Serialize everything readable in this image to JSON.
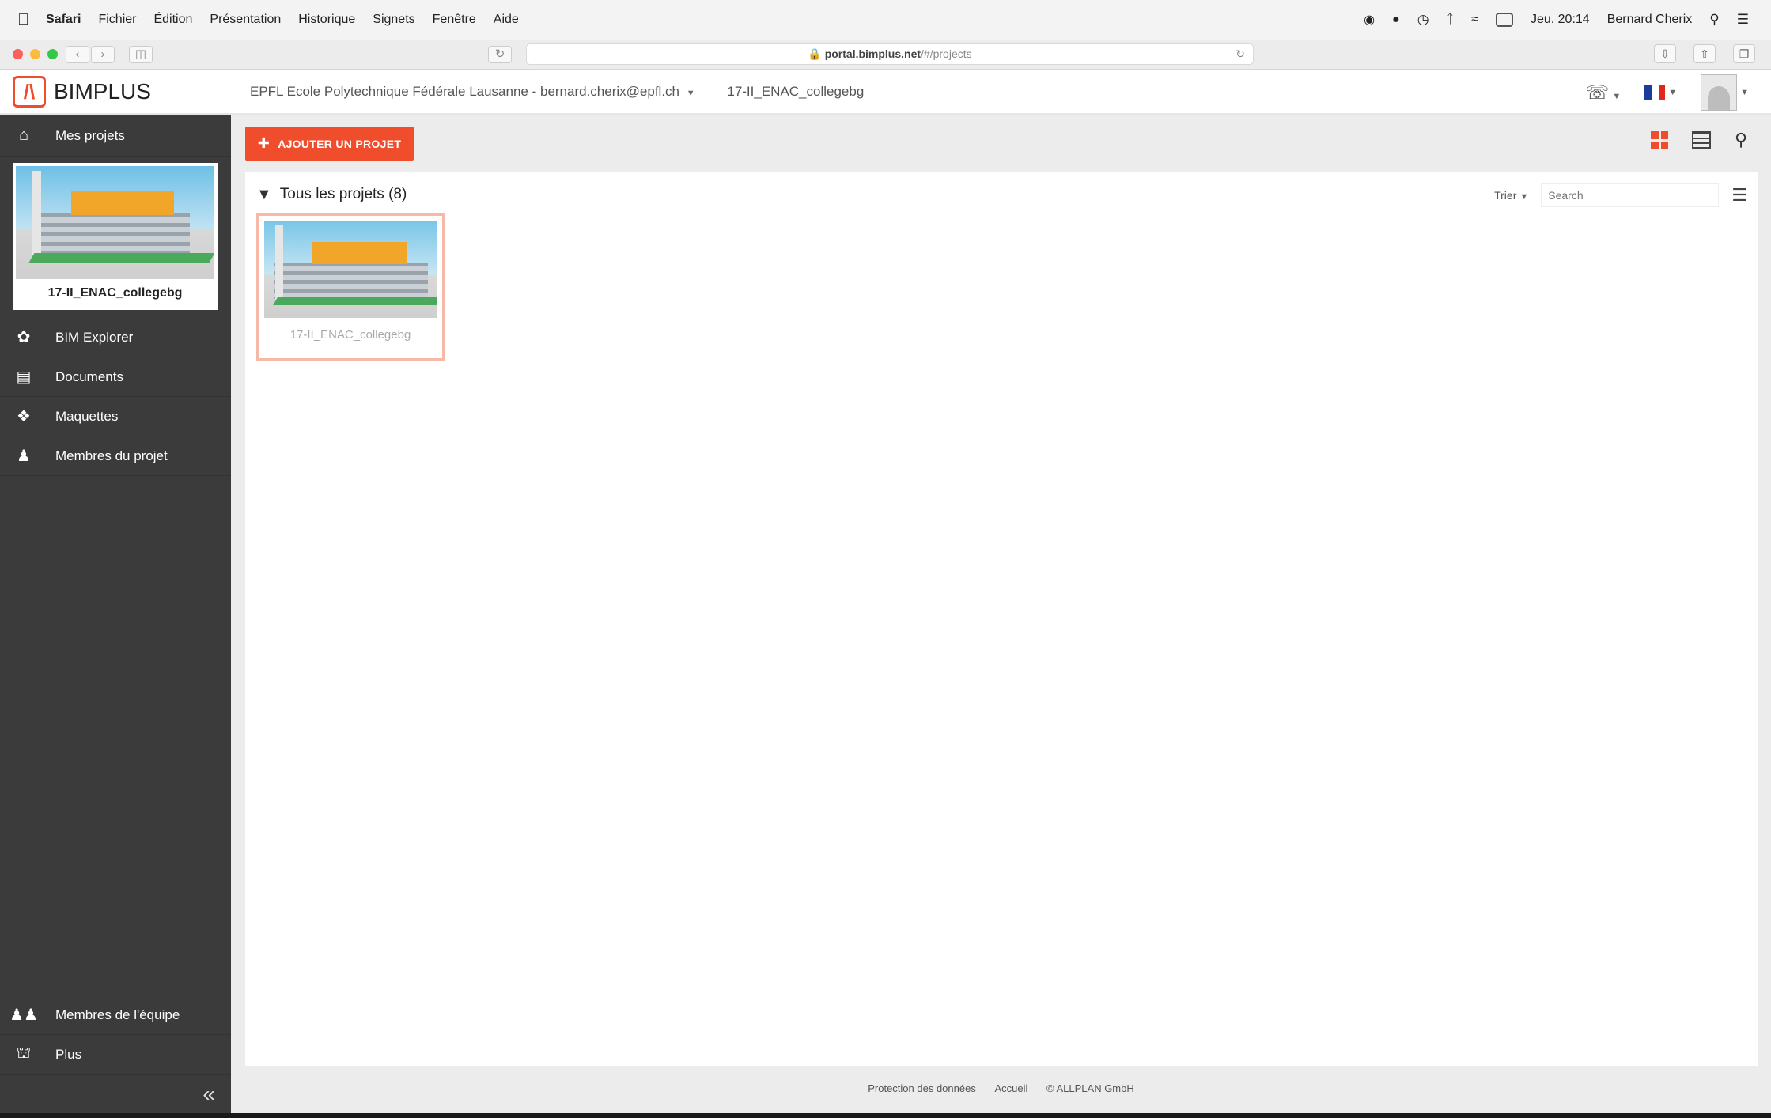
{
  "menubar": {
    "app": "Safari",
    "items": [
      "Fichier",
      "Édition",
      "Présentation",
      "Historique",
      "Signets",
      "Fenêtre",
      "Aide"
    ],
    "clock": "Jeu. 20:14",
    "user": "Bernard Cherix"
  },
  "browser": {
    "url_host": "portal.bimplus.net",
    "url_path": "/#/projects"
  },
  "header": {
    "logo_text": "BIMPLUS",
    "org": "EPFL Ecole Polytechnique Fédérale Lausanne - bernard.cherix@epfl.ch",
    "project": "17-II_ENAC_collegebg"
  },
  "sidebar": {
    "home": "Mes projets",
    "project_label": "17-II_ENAC_collegebg",
    "items": [
      "BIM Explorer",
      "Documents",
      "Maquettes",
      "Membres du projet"
    ],
    "bottom": [
      "Membres de l'équipe",
      "Plus"
    ]
  },
  "main": {
    "add_button": "AJOUTER UN PROJET",
    "list_title": "Tous les projets (8)",
    "sort_label": "Trier",
    "search_placeholder": "Search",
    "cards": [
      {
        "label": "17-II_ENAC_collegebg"
      }
    ]
  },
  "footer": [
    "Protection des données",
    "Accueil",
    "© ALLPLAN GmbH"
  ],
  "colors": {
    "accent": "#ef4d2c",
    "sidebar": "#3b3b3b"
  }
}
